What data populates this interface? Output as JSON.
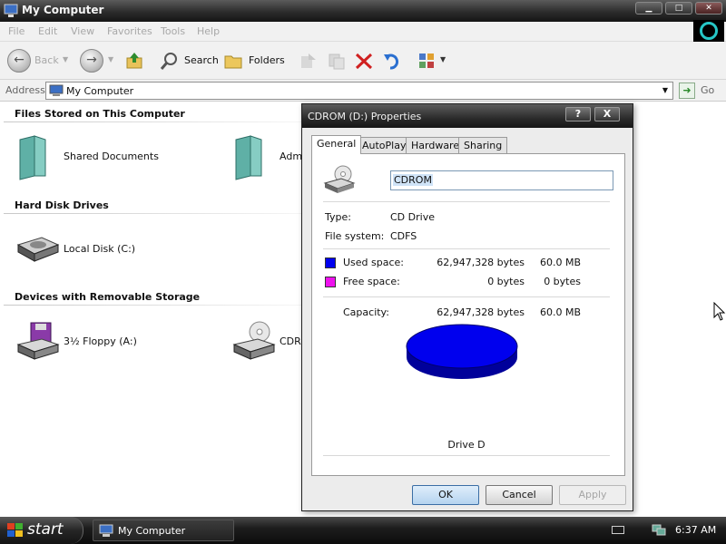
{
  "window": {
    "title": "My Computer",
    "buttons": {
      "minimize": "▁",
      "maximize": "□",
      "close": "✕"
    }
  },
  "menubar": [
    "File",
    "Edit",
    "View",
    "Favorites",
    "Tools",
    "Help"
  ],
  "toolbar": {
    "back_label": "Back",
    "search_label": "Search",
    "folders_label": "Folders"
  },
  "address": {
    "label": "Address",
    "value": "My Computer",
    "go_label": "Go"
  },
  "content": {
    "groups": [
      {
        "heading": "Files Stored on This Computer"
      },
      {
        "heading": "Hard Disk Drives"
      },
      {
        "heading": "Devices with Removable Storage"
      }
    ],
    "items": [
      {
        "label": "Shared Documents",
        "icon": "folder-icon"
      },
      {
        "label": "Adm",
        "icon": "folder-icon"
      },
      {
        "label": "Local Disk (C:)",
        "icon": "hard-disk-icon"
      },
      {
        "label": "3½ Floppy (A:)",
        "icon": "floppy-drive-icon"
      },
      {
        "label": "CDR",
        "icon": "cd-drive-icon"
      }
    ]
  },
  "dialog": {
    "title": "CDROM (D:) Properties",
    "help_btn": "?",
    "close_btn": "X",
    "tabs": [
      "General",
      "AutoPlay",
      "Hardware",
      "Sharing"
    ],
    "name_value": "CDROM",
    "type_label": "Type:",
    "type_value": "CD Drive",
    "fs_label": "File system:",
    "fs_value": "CDFS",
    "used_label": "Used space:",
    "used_bytes": "62,947,328 bytes",
    "used_size": "60.0 MB",
    "free_label": "Free space:",
    "free_bytes": "0 bytes",
    "free_size": "0 bytes",
    "capacity_label": "Capacity:",
    "capacity_bytes": "62,947,328 bytes",
    "capacity_size": "60.0 MB",
    "drive_label": "Drive D",
    "used_color": "#0000ee",
    "free_color": "#ee11ee",
    "ok": "OK",
    "cancel": "Cancel",
    "apply": "Apply"
  },
  "taskbar": {
    "start": "start",
    "task": "My Computer",
    "clock": "6:37 AM"
  }
}
